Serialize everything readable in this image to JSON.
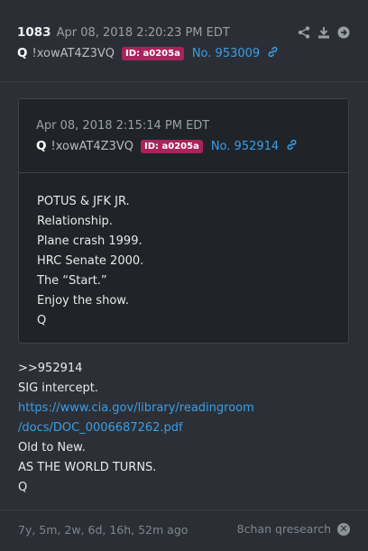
{
  "post": {
    "number": "1083",
    "date": "Apr 08, 2018 2:20:23 PM EDT",
    "author": "Q",
    "tripcode": "!xowAT4Z3VQ",
    "id_badge": "ID: a0205a",
    "ref": "No. 953009",
    "icons": [
      "share-icon",
      "download-icon",
      "arrow-right-circle-icon"
    ]
  },
  "quoted": {
    "date": "Apr 08, 2018 2:15:14 PM EDT",
    "author": "Q",
    "tripcode": "!xowAT4Z3VQ",
    "id_badge": "ID: a0205a",
    "ref": "No. 952914",
    "lines": [
      "POTUS & JFK JR.",
      "Relationship.",
      "Plane crash 1999.",
      "HRC Senate 2000.",
      "The “Start.”",
      "Enjoy the show.",
      "Q"
    ]
  },
  "body": {
    "reply_ref": ">>952914",
    "line1": "SIG intercept.",
    "url_part1": "https://www.cia.gov/library/readingroom",
    "url_part2": "/docs/DOC_0006687262.pdf",
    "line2": "Old to New.",
    "line3": "AS THE WORLD TURNS.",
    "line4": "Q"
  },
  "footer": {
    "age": "7y, 5m, 2w, 6d, 16h, 52m ago",
    "source": "8chan qresearch",
    "close_icon": "close-icon"
  },
  "colors": {
    "background": "#2c3036",
    "quote_background": "#202429",
    "badge": "#a8245c",
    "link": "#3a9ee8"
  }
}
